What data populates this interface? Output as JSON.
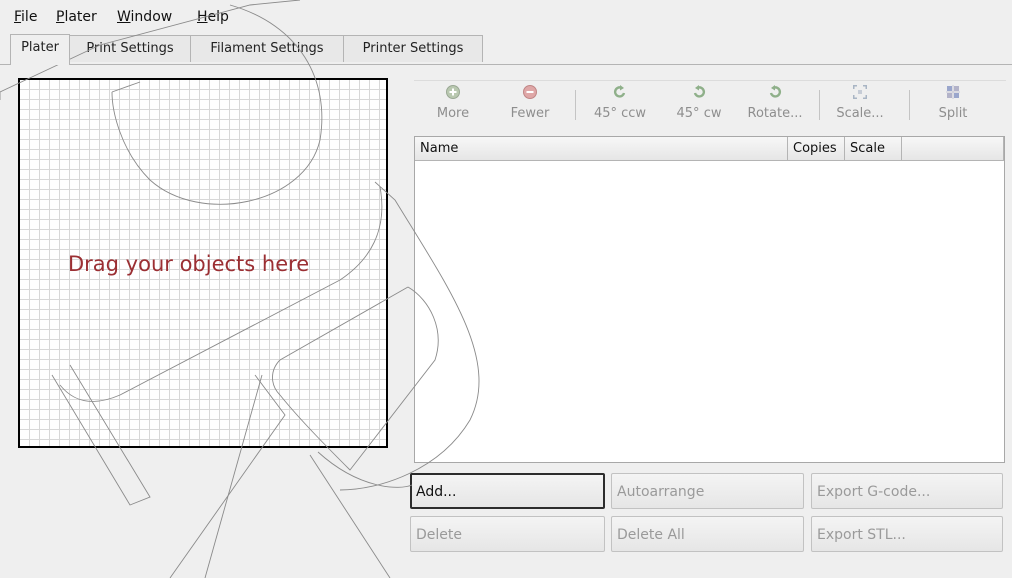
{
  "menubar": {
    "items": [
      "File",
      "Plater",
      "Window",
      "Help"
    ]
  },
  "tabs": [
    {
      "label": "Plater",
      "active": true
    },
    {
      "label": "Print Settings",
      "active": false
    },
    {
      "label": "Filament Settings",
      "active": false
    },
    {
      "label": "Printer Settings",
      "active": false
    }
  ],
  "plater": {
    "bed_hint": "Drag your objects here",
    "toolbar": [
      {
        "label": "More",
        "icon": "add-icon",
        "enabled": false
      },
      {
        "label": "Fewer",
        "icon": "remove-icon",
        "enabled": false
      },
      {
        "label": "45° ccw",
        "icon": "rotate-ccw-icon",
        "enabled": false
      },
      {
        "label": "45° cw",
        "icon": "rotate-cw-icon",
        "enabled": false
      },
      {
        "label": "Rotate...",
        "icon": "rotate-icon",
        "enabled": false
      },
      {
        "label": "Scale...",
        "icon": "scale-icon",
        "enabled": false
      },
      {
        "label": "Split",
        "icon": "split-icon",
        "enabled": false
      }
    ],
    "object_list": {
      "columns": [
        "Name",
        "Copies",
        "Scale",
        ""
      ],
      "rows": []
    },
    "buttons": {
      "add": "Add...",
      "autoarrange": "Autoarrange",
      "export_gcode": "Export G-code...",
      "delete": "Delete",
      "delete_all": "Delete All",
      "export_stl": "Export STL..."
    }
  },
  "colors": {
    "hint_text": "#9b2f33",
    "disabled_text": "#8e8e8e",
    "bed_border": "#000000"
  }
}
